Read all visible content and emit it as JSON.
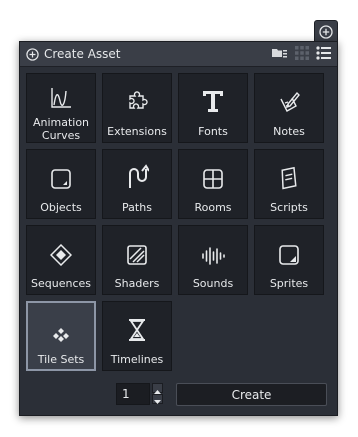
{
  "header": {
    "title": "Create Asset",
    "add_icon": "plus-circle-icon",
    "tools": [
      "folder-view-icon",
      "grid-view-icon",
      "list-view-icon"
    ]
  },
  "float_button_icon": "plus-circle-icon",
  "tiles": [
    {
      "label": "Animation Curves",
      "icon": "curve-icon",
      "selected": false
    },
    {
      "label": "Extensions",
      "icon": "puzzle-icon",
      "selected": false
    },
    {
      "label": "Fonts",
      "icon": "font-T-icon",
      "selected": false
    },
    {
      "label": "Notes",
      "icon": "note-pencil-icon",
      "selected": false
    },
    {
      "label": "Objects",
      "icon": "object-square-icon",
      "selected": false
    },
    {
      "label": "Paths",
      "icon": "path-arrow-icon",
      "selected": false
    },
    {
      "label": "Rooms",
      "icon": "room-grid-icon",
      "selected": false
    },
    {
      "label": "Scripts",
      "icon": "script-scroll-icon",
      "selected": false
    },
    {
      "label": "Sequences",
      "icon": "sequence-diamond-icon",
      "selected": false
    },
    {
      "label": "Shaders",
      "icon": "shader-square-icon",
      "selected": false
    },
    {
      "label": "Sounds",
      "icon": "sound-wave-icon",
      "selected": false
    },
    {
      "label": "Sprites",
      "icon": "sprite-square-icon",
      "selected": false
    },
    {
      "label": "Tile Sets",
      "icon": "tileset-diamonds-icon",
      "selected": true
    },
    {
      "label": "Timelines",
      "icon": "hourglass-icon",
      "selected": false
    }
  ],
  "footer": {
    "count_value": "1",
    "create_label": "Create"
  },
  "colors": {
    "panel_bg": "#2b2f37",
    "tile_bg": "#1f2228",
    "header_bg": "#3a3e47",
    "selected_border": "#8d96a6",
    "text": "#e8eaec"
  }
}
